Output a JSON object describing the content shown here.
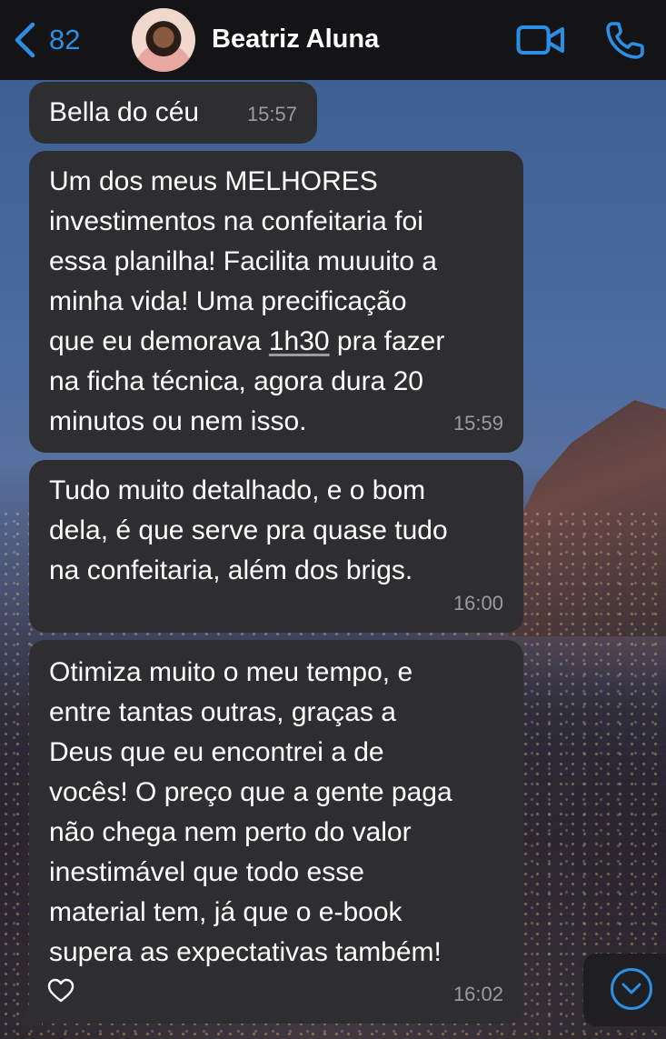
{
  "header": {
    "back_count": "82",
    "contact_name": "Beatriz Aluna",
    "icons": [
      "chevron-left-icon",
      "avatar",
      "video-camera-icon",
      "phone-icon"
    ],
    "accent_color": "#2b8fe6"
  },
  "messages": [
    {
      "text": "Bella do céu",
      "time": "15:57"
    },
    {
      "text_before": "Um dos meus MELHORES\ninvestimentos na confeitaria foi\nessa planilha! Facilita muuuito a\nminha vida! Uma precificação\nque eu demorava ",
      "text_link": "1h30",
      "text_after": " pra fazer\nna ficha técnica, agora dura 20\nminutos ou nem isso.",
      "time": "15:59"
    },
    {
      "text": "Tudo muito detalhado, e o bom\ndela, é que serve pra quase tudo\nna confeitaria, além dos brigs.",
      "time": "16:00"
    },
    {
      "text": "Otimiza muito o meu tempo, e\nentre tantas outras, graças a\nDeus que eu encontrei a de\nvocês! O preço que a gente paga\nnão chega nem perto do valor\ninestimável que todo esse\nmaterial tem, já que o e-book\nsupera as expectativas também!",
      "time": "16:02",
      "reaction_icon": "heart-icon"
    }
  ],
  "colors": {
    "bubble": "#2e2e31",
    "timestamp": "#9b9ba0",
    "header_bg": "#141416"
  }
}
